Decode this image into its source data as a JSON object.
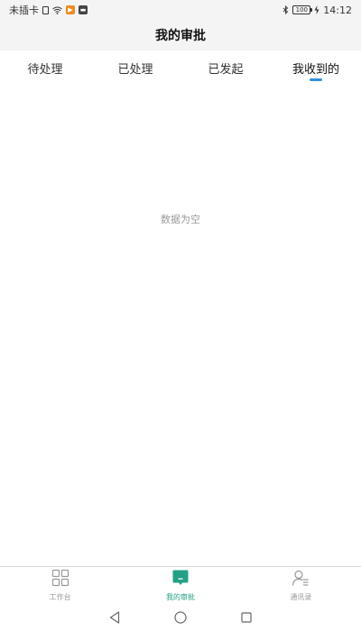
{
  "status_bar": {
    "carrier": "未插卡",
    "battery": "100",
    "time": "14:12"
  },
  "header": {
    "title": "我的审批"
  },
  "tabs": [
    {
      "label": "待处理",
      "active": false
    },
    {
      "label": "已处理",
      "active": false
    },
    {
      "label": "已发起",
      "active": false
    },
    {
      "label": "我收到的",
      "active": true
    }
  ],
  "content": {
    "empty_text": "数据为空"
  },
  "bottom_nav": [
    {
      "label": "工作台",
      "icon": "grid-icon",
      "active": false
    },
    {
      "label": "我的审批",
      "icon": "approval-icon",
      "active": true
    },
    {
      "label": "通讯录",
      "icon": "contacts-icon",
      "active": false
    }
  ],
  "colors": {
    "accent": "#24a085",
    "tab_indicator": "#2f8fd8",
    "header_bg": "#f4f4f4",
    "muted_text": "#9a9a9a"
  }
}
